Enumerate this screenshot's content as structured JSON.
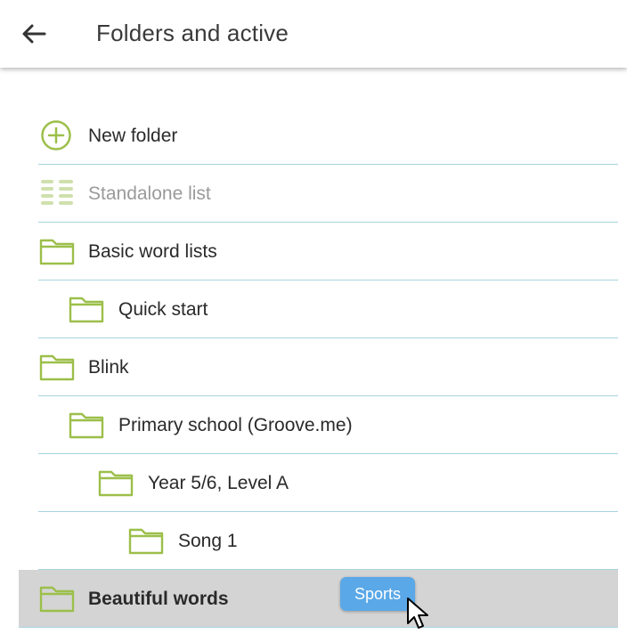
{
  "header": {
    "title": "Folders and active"
  },
  "list": {
    "items": [
      {
        "label": "New folder",
        "icon": "plus-circle-icon"
      },
      {
        "label": "Standalone list",
        "icon": "list-icon"
      },
      {
        "label": "Basic word lists",
        "icon": "folder-icon"
      },
      {
        "label": "Quick start",
        "icon": "folder-icon"
      },
      {
        "label": "Blink",
        "icon": "folder-icon"
      },
      {
        "label": "Primary school (Groove.me)",
        "icon": "folder-icon"
      },
      {
        "label": "Year 5/6, Level A",
        "icon": "folder-icon"
      },
      {
        "label": "Song 1",
        "icon": "folder-icon"
      },
      {
        "label": "Beautiful words",
        "icon": "folder-icon"
      }
    ]
  },
  "drag_chip": {
    "label": "Sports"
  },
  "colors": {
    "accent": "#9cbf4a",
    "divider": "#a8d3e0",
    "selected_bg": "#d4d4d4",
    "chip": "#5aa8e8"
  }
}
